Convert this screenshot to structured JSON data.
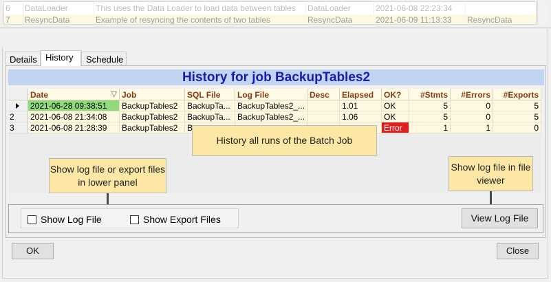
{
  "top_grid": {
    "rows": [
      {
        "num": "6",
        "name": "DataLoader",
        "desc": "This uses the Data Loader to load data between tables",
        "group": "DataLoader",
        "time": "2021-06-08 22:23:34",
        "extra": ""
      },
      {
        "num": "7",
        "name": "ResyncData",
        "desc": "Example of resyncing the contents of two tables",
        "group": "ResyncData",
        "time": "2021-06-09 11:13:33",
        "extra": "ResyncData"
      }
    ]
  },
  "tabs": {
    "details": "Details",
    "history": "History",
    "schedule": "Schedule"
  },
  "history": {
    "title": "History for job BackupTables2",
    "headers": {
      "date": "Date",
      "job": "Job",
      "sql_file": "SQL File",
      "log_file": "Log File",
      "desc": "Desc",
      "elapsed": "Elapsed",
      "ok": "OK?",
      "stmts": "#Stmts",
      "errors": "#Errors",
      "exports": "#Exports"
    },
    "rows": [
      {
        "rownum": "",
        "date": "2021-06-28 09:38:51",
        "job": "BackupTables2",
        "sql_file": "BackupTa...",
        "log_file": "BackupTables2_...",
        "desc": "",
        "elapsed": "1.01",
        "ok": "OK",
        "stmts": "5",
        "errors": "0",
        "exports": "5"
      },
      {
        "rownum": "2",
        "date": "2021-06-08 21:34:08",
        "job": "BackupTables2",
        "sql_file": "BackupTa...",
        "log_file": "BackupTables2_...",
        "desc": "",
        "elapsed": "1.06",
        "ok": "OK",
        "stmts": "5",
        "errors": "0",
        "exports": "5"
      },
      {
        "rownum": "3",
        "date": "2021-06-08 21:28:39",
        "job": "BackupTables2",
        "sql_file": "B",
        "log_file": "",
        "desc": "",
        "elapsed": "",
        "ok": "Error",
        "stmts": "1",
        "errors": "1",
        "exports": "0"
      }
    ]
  },
  "callouts": {
    "history": "History all runs of the Batch Job",
    "show_log": "Show log file or export files in lower panel",
    "viewer": "Show log file in file viewer"
  },
  "lower": {
    "show_log_file": "Show Log File",
    "show_export_files": "Show Export Files",
    "view_log_file": "View Log File"
  },
  "footer": {
    "ok": "OK",
    "close": "Close"
  },
  "colors": {
    "title_bg": "#c1d5f2",
    "title_fg": "#1a1eb0",
    "selected": "#8fdb7c",
    "error": "#e02020",
    "callout": "#fde7a5",
    "header_fg": "#8b3a0f"
  },
  "icons": {
    "sort": "sort-descending-icon",
    "row_pointer": "current-row-pointer-icon",
    "callout_arrow": "arrow-down-icon"
  }
}
